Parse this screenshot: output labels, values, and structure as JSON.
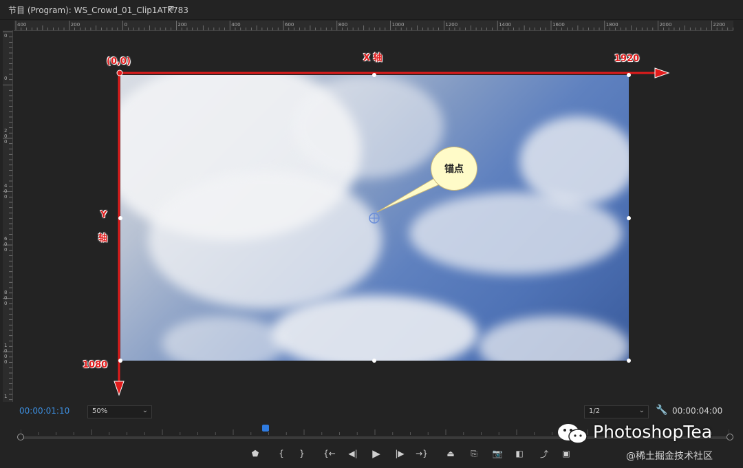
{
  "panel": {
    "title": "节目 (Program): WS_Crowd_01_Clip1ATK783",
    "menu_icon": "hamburger-icon"
  },
  "ruler": {
    "top_labels": [
      "400",
      "200",
      "0",
      "200",
      "400",
      "600",
      "800",
      "1000",
      "1200",
      "1400",
      "1600",
      "1800",
      "2000",
      "2200"
    ],
    "left_labels": [
      "0",
      "0",
      "2\n0\n0",
      "4\n0\n0",
      "6\n0\n0",
      "8\n0\n0",
      "1\n0\n0\n0",
      "1"
    ]
  },
  "annotations": {
    "origin_label": "(0,0)",
    "x_axis_label": "X 轴",
    "x_max_label": "1920",
    "y_axis_label_1": "Y",
    "y_axis_label_2": "轴",
    "y_max_label": "1080",
    "anchor_label": "锚点"
  },
  "controls": {
    "current_timecode": "00:00:01:10",
    "zoom_value": "50%",
    "resolution_value": "1/2",
    "duration_timecode": "00:00:04:00",
    "wrench_icon": "wrench-icon"
  },
  "transport": {
    "buttons": [
      {
        "name": "add-marker-button",
        "icon": "marker-icon",
        "glyph": "⬟"
      },
      {
        "name": "mark-in-button",
        "icon": "mark-in-icon",
        "glyph": "{"
      },
      {
        "name": "mark-out-button",
        "icon": "mark-out-icon",
        "glyph": "}"
      },
      {
        "name": "go-to-in-button",
        "icon": "go-to-in-icon",
        "glyph": "{←"
      },
      {
        "name": "step-back-button",
        "icon": "step-back-icon",
        "glyph": "◀|"
      },
      {
        "name": "play-button",
        "icon": "play-icon",
        "glyph": "▶"
      },
      {
        "name": "step-forward-button",
        "icon": "step-forward-icon",
        "glyph": "|▶"
      },
      {
        "name": "go-to-out-button",
        "icon": "go-to-out-icon",
        "glyph": "→}"
      },
      {
        "name": "lift-button",
        "icon": "lift-icon",
        "glyph": "⏏"
      },
      {
        "name": "extract-button",
        "icon": "extract-icon",
        "glyph": "⎘"
      },
      {
        "name": "export-frame-button",
        "icon": "camera-icon",
        "glyph": "📷"
      },
      {
        "name": "compare-view-button",
        "icon": "compare-icon",
        "glyph": "◧"
      },
      {
        "name": "insert-button",
        "icon": "insert-icon",
        "glyph": "⤴"
      },
      {
        "name": "settings-button",
        "icon": "safe-margins-icon",
        "glyph": "▣"
      }
    ]
  },
  "watermark": {
    "brand": "PhotoshopTea",
    "site": "@稀土掘金技术社区"
  },
  "colors": {
    "axis_red": "#e11b1b",
    "timecode_blue": "#3d8fe0",
    "background": "#232323"
  }
}
